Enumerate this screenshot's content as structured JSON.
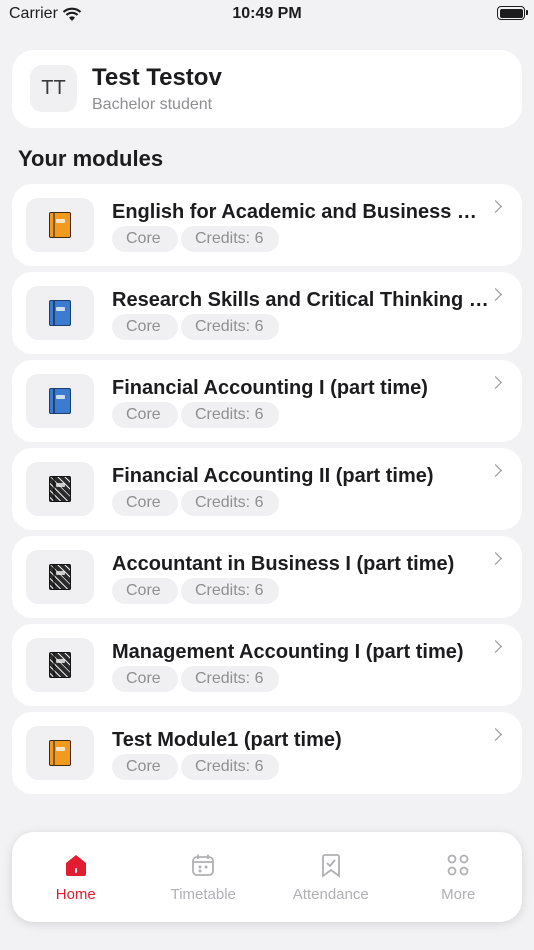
{
  "status_bar": {
    "carrier": "Carrier",
    "time": "10:49 PM"
  },
  "profile": {
    "initials": "TT",
    "name": "Test Testov",
    "role": "Bachelor student"
  },
  "section_title": "Your modules",
  "modules": [
    {
      "title": "English for Academic and Business Purposes",
      "type": "Core",
      "credits": "Credits: 6",
      "icon": "orange-book-icon"
    },
    {
      "title": "Research Skills and Critical Thinking (part time)",
      "type": "Core",
      "credits": "Credits: 6",
      "icon": "blue-book-icon"
    },
    {
      "title": "Financial Accounting I (part time)",
      "type": "Core",
      "credits": "Credits: 6",
      "icon": "blue-book-icon"
    },
    {
      "title": "Financial Accounting II (part time)",
      "type": "Core",
      "credits": "Credits: 6",
      "icon": "notebook-icon"
    },
    {
      "title": "Accountant in Business I (part time)",
      "type": "Core",
      "credits": "Credits: 6",
      "icon": "notebook-icon"
    },
    {
      "title": "Management Accounting I (part time)",
      "type": "Core",
      "credits": "Credits: 6",
      "icon": "notebook-icon"
    },
    {
      "title": "Test Module1 (part time)",
      "type": "Core",
      "credits": "Credits: 6",
      "icon": "orange-book-icon"
    }
  ],
  "tabs": [
    {
      "label": "Home",
      "icon": "home-icon",
      "active": true
    },
    {
      "label": "Timetable",
      "icon": "calendar-icon",
      "active": false
    },
    {
      "label": "Attendance",
      "icon": "bookmark-check-icon",
      "active": false
    },
    {
      "label": "More",
      "icon": "grid-dots-icon",
      "active": false
    }
  ],
  "colors": {
    "accent": "#e11d2f",
    "background": "#f2f2f4",
    "card": "#ffffff",
    "muted": "#8e8e93"
  }
}
